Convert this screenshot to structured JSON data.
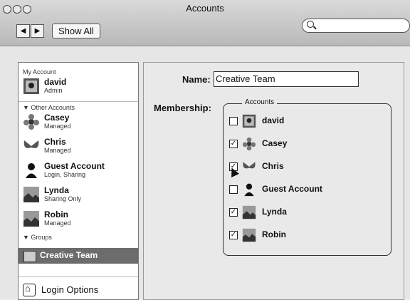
{
  "window": {
    "title": "Accounts",
    "toolbar": {
      "show_all_label": "Show All",
      "search_icon": "search-icon",
      "back_icon": "chevron-left-icon",
      "forward_icon": "chevron-right-icon"
    }
  },
  "sidebar": {
    "my_account_label": "My Account",
    "my_account": {
      "name": "david",
      "role": "Admin",
      "icon": "user-photo-icon"
    },
    "other_accounts_label": "▼ Other Accounts",
    "other_accounts": [
      {
        "name": "Casey",
        "role": "Managed",
        "icon": "flower-icon"
      },
      {
        "name": "Chris",
        "role": "Managed",
        "icon": "butterfly-icon"
      },
      {
        "name": "Guest Account",
        "role": "Login, Sharing",
        "icon": "person-silhouette-icon"
      },
      {
        "name": "Lynda",
        "role": "Sharing Only",
        "icon": "photo-icon"
      },
      {
        "name": "Robin",
        "role": "Managed",
        "icon": "photo-icon"
      }
    ],
    "groups_label": "▼ Groups",
    "selected_group": {
      "name": "Creative Team",
      "icon": "group-icon"
    },
    "login_options_label": "Login Options",
    "login_icon": "home-icon"
  },
  "group": {
    "name_label": "Name:",
    "name_value": "Creative Team",
    "membership_label": "Membership:",
    "accounts_legend": "Accounts",
    "members": [
      {
        "name": "david",
        "checked": false,
        "icon": "user-photo-icon"
      },
      {
        "name": "Casey",
        "checked": true,
        "icon": "flower-icon"
      },
      {
        "name": "Chris",
        "checked": true,
        "icon": "butterfly-icon"
      },
      {
        "name": "Guest Account",
        "checked": false,
        "icon": "person-silhouette-icon"
      },
      {
        "name": "Lynda",
        "checked": true,
        "icon": "photo-icon"
      },
      {
        "name": "Robin",
        "checked": true,
        "icon": "photo-icon"
      }
    ]
  }
}
